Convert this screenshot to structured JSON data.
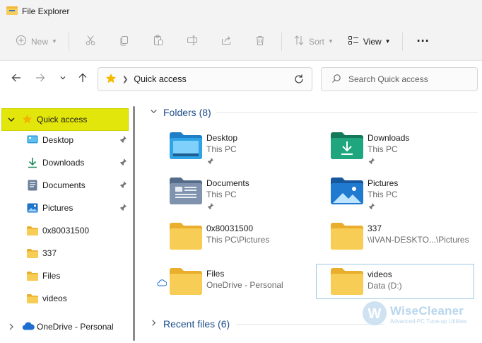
{
  "window": {
    "title": "File Explorer"
  },
  "toolbar": {
    "new_label": "New",
    "sort_label": "Sort",
    "view_label": "View",
    "more_label": "···"
  },
  "address": {
    "current": "Quick access",
    "search_placeholder": "Search Quick access"
  },
  "sidebar": {
    "quick_access": "Quick access",
    "items": [
      {
        "label": "Desktop",
        "icon": "desktop-icon",
        "pinned": true
      },
      {
        "label": "Downloads",
        "icon": "download-icon",
        "pinned": true
      },
      {
        "label": "Documents",
        "icon": "documents-icon",
        "pinned": true
      },
      {
        "label": "Pictures",
        "icon": "pictures-icon",
        "pinned": true
      },
      {
        "label": "0x80031500",
        "icon": "folder-icon",
        "pinned": false
      },
      {
        "label": "337",
        "icon": "folder-icon",
        "pinned": false
      },
      {
        "label": "Files",
        "icon": "folder-icon",
        "pinned": false
      },
      {
        "label": "videos",
        "icon": "folder-icon",
        "pinned": false
      }
    ],
    "onedrive": "OneDrive - Personal"
  },
  "content": {
    "folders_header": "Folders (8)",
    "recent_header": "Recent files (6)",
    "folders": [
      {
        "name": "Desktop",
        "location": "This PC",
        "icon": "desktop-folder-icon",
        "pinned": true
      },
      {
        "name": "Downloads",
        "location": "This PC",
        "icon": "downloads-folder-icon",
        "pinned": true
      },
      {
        "name": "Documents",
        "location": "This PC",
        "icon": "documents-folder-icon",
        "pinned": true
      },
      {
        "name": "Pictures",
        "location": "This PC",
        "icon": "pictures-folder-icon",
        "pinned": true
      },
      {
        "name": "0x80031500",
        "location": "This PC\\Pictures",
        "icon": "folder-icon",
        "pinned": false
      },
      {
        "name": "337",
        "location": "\\\\IVAN-DESKTO...\\Pictures",
        "icon": "folder-icon",
        "pinned": false
      },
      {
        "name": "Files",
        "location": "OneDrive - Personal",
        "icon": "folder-icon",
        "pinned": false
      },
      {
        "name": "videos",
        "location": "Data (D:)",
        "icon": "folder-icon",
        "pinned": false
      }
    ]
  },
  "watermark": {
    "name": "WiseCleaner",
    "tagline": "Advanced PC Tune-up Utilities"
  },
  "colors": {
    "highlight": "#e3e60b",
    "accent": "#1e4e8c",
    "folder": "#f6c94a"
  }
}
